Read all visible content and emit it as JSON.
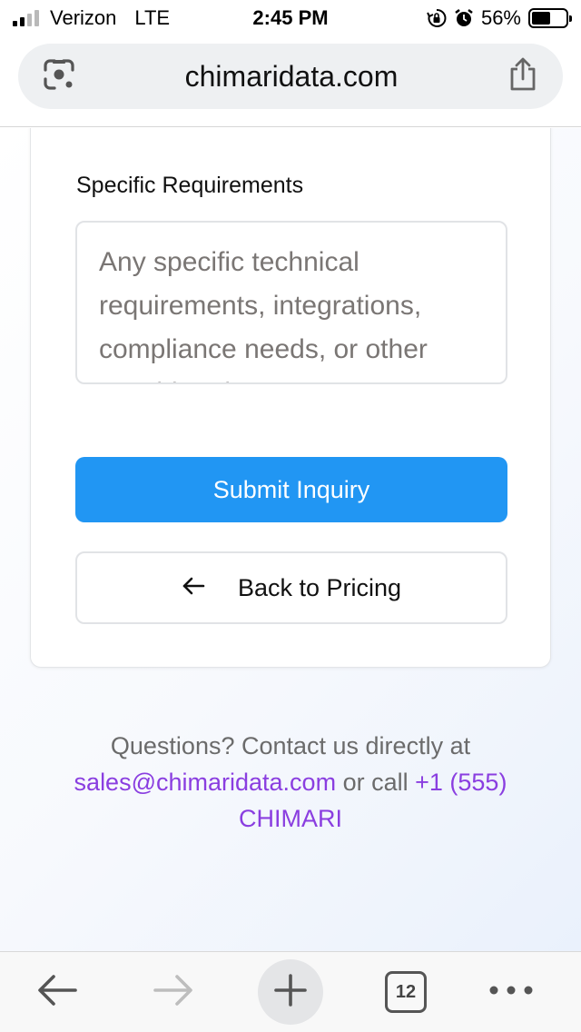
{
  "status_bar": {
    "carrier": "Verizon",
    "network": "LTE",
    "time": "2:45 PM",
    "battery_percent": "56%",
    "battery_level": 0.56
  },
  "browser": {
    "url": "chimaridata.com",
    "tab_count": "12"
  },
  "form": {
    "requirements_label": "Specific Requirements",
    "requirements_placeholder": "Any specific technical requirements, integrations, compliance needs, or other considerations",
    "submit_label": "Submit Inquiry",
    "back_label": "Back to Pricing"
  },
  "contact": {
    "prefix": "Questions? Contact us directly at",
    "email": "sales@chimaridata.com",
    "middle": "or call",
    "phone": "+1 (555) CHIMARI"
  },
  "colors": {
    "primary_button": "#2196f3",
    "link": "#8a3ee0"
  },
  "icons": {
    "lens": "google-lens-icon",
    "share": "share-icon",
    "back_arrow": "arrow-left-icon",
    "nav_back": "nav-back-icon",
    "nav_forward": "nav-forward-icon",
    "new_tab": "plus-icon",
    "more": "more-dots-icon"
  }
}
